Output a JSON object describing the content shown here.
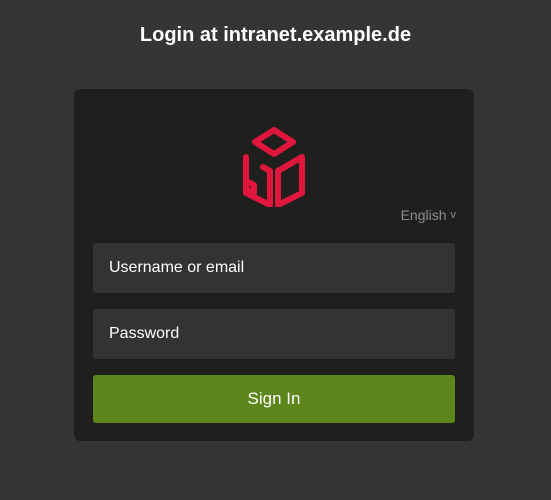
{
  "header": {
    "title": "Login at intranet.example.de"
  },
  "login": {
    "language": "English",
    "language_icon": "chevron-down-icon",
    "username_placeholder": "Username or email",
    "password_placeholder": "Password",
    "signin_label": "Sign In",
    "logo_icon": "cube-logo-icon"
  },
  "colors": {
    "page_background": "#353535",
    "card_background": "#1f1f1e",
    "field_background": "#333333",
    "accent_button": "#5d861d",
    "logo_red": "#e0163c",
    "muted_text": "#8d8d8d"
  }
}
